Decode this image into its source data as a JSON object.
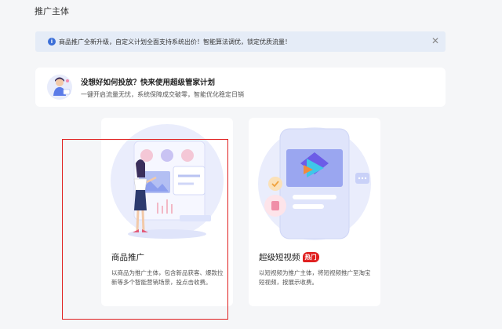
{
  "page": {
    "title": "推广主体"
  },
  "notice": {
    "text": "商品推广全新升级，自定义计划全面支持系统出价！智能算法调优，锁定优质流量！",
    "close_glyph": "✕"
  },
  "banner": {
    "title": "没想好如何投放？快来使用超级管家计划",
    "subtitle": "一键开启流量无忧，系统保障成交破零，智能优化稳定日销"
  },
  "cards": [
    {
      "title": "商品推广",
      "description": "以商品为推广主体，包含新品获客、爆款拉新等多个智能营销场景，投点击收费。"
    },
    {
      "title": "超级短视频",
      "badge": "热门",
      "description": "以短视频为推广主体，将短视频推广至淘宝短视频，按展示收费。"
    }
  ],
  "colors": {
    "accent": "#3b6fd8",
    "hot_badge": "#e02020",
    "highlight_border": "#e02020"
  },
  "icons": [
    "info-icon",
    "close-icon",
    "assistant-avatar-icon",
    "goods-promo-illustration",
    "video-promo-illustration"
  ]
}
